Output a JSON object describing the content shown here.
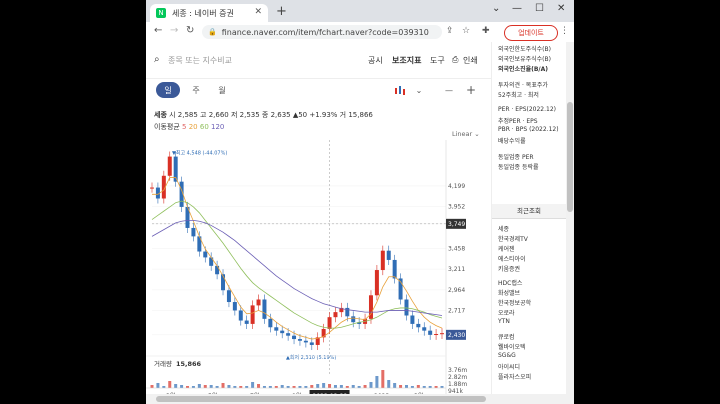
{
  "browser": {
    "tab_title": "세종 : 네이버 증권",
    "favicon_letter": "N",
    "url": "finance.naver.com/item/fchart.naver?code=039310",
    "update_label": "업데이트",
    "icons": [
      "back-icon",
      "forward-icon",
      "reload-icon",
      "lock-icon",
      "share-icon",
      "star-icon",
      "extensions-icon",
      "sidebar-icon",
      "profile-icon",
      "menu-icon"
    ]
  },
  "toolbar": {
    "search_placeholder": "종목 또는 지수비교",
    "links": [
      "공시",
      "보조지표",
      "도구",
      "인쇄"
    ]
  },
  "periods": [
    "일",
    "주",
    "월"
  ],
  "active_period": "일",
  "stock": {
    "name": "세종",
    "info": "시 2,585  고 2,660  저 2,535  종 2,635  ▲50  +1.93%  거 15,866",
    "ma_label": "이동평균",
    "ma_values": [
      "5",
      "20",
      "60",
      "120"
    ],
    "scale": "Linear"
  },
  "chart_data": {
    "type": "line",
    "x": [
      "3월",
      "5월",
      "7월",
      "9월",
      "11월",
      "2023",
      "3월"
    ],
    "y_ticks": [
      4199,
      3952,
      3749,
      3458,
      3211,
      2964,
      2717,
      2430
    ],
    "current_price": "2,430",
    "high_label": "▼최고 4,548 (-44.07%)",
    "low_label": "▲최저 2,310 (5.19%)",
    "crosshair_date": "2022-12-22",
    "volume_label": "거래량",
    "volume": "15,866",
    "volume_ticks": [
      "3.76m",
      "2.82m",
      "1.88m",
      "941k"
    ],
    "series": [
      {
        "values": [
          4180,
          4050,
          4320,
          4548,
          4250,
          3950,
          3700,
          3600,
          3420,
          3350,
          3250,
          3150,
          2960,
          2820,
          2720,
          2600,
          2560,
          2780,
          2850,
          2620,
          2520,
          2480,
          2450,
          2420,
          2380,
          2360,
          2340,
          2310,
          2400,
          2500,
          2640,
          2700,
          2750,
          2650,
          2580,
          2560,
          2620,
          2900,
          3200,
          3430,
          3320,
          3100,
          2850,
          2660,
          2560,
          2520,
          2480,
          2430,
          2440,
          2450
        ]
      },
      {
        "values": [
          4100,
          4100,
          4150,
          4300,
          4300,
          4150,
          3950,
          3780,
          3600,
          3450,
          3350,
          3250,
          3130,
          3000,
          2880,
          2760,
          2680,
          2690,
          2720,
          2690,
          2640,
          2580,
          2530,
          2490,
          2450,
          2420,
          2400,
          2380,
          2390,
          2410,
          2460,
          2520,
          2580,
          2620,
          2630,
          2620,
          2610,
          2680,
          2820,
          3000,
          3120,
          3120,
          3060,
          2950,
          2830,
          2720,
          2640,
          2580,
          2540,
          2510
        ]
      },
      {
        "values": [
          3800,
          3850,
          3900,
          3950,
          4000,
          4020,
          4000,
          3950,
          3880,
          3790,
          3700,
          3610,
          3520,
          3420,
          3320,
          3220,
          3130,
          3050,
          2990,
          2940,
          2890,
          2840,
          2790,
          2740,
          2690,
          2650,
          2610,
          2570,
          2540,
          2520,
          2510,
          2510,
          2520,
          2540,
          2560,
          2580,
          2590,
          2610,
          2640,
          2680,
          2720,
          2740,
          2750,
          2750,
          2740,
          2720,
          2700,
          2670,
          2650,
          2630
        ]
      },
      {
        "values": [
          3600,
          3640,
          3680,
          3720,
          3760,
          3780,
          3790,
          3790,
          3780,
          3760,
          3730,
          3690,
          3650,
          3600,
          3550,
          3490,
          3430,
          3370,
          3310,
          3250,
          3190,
          3130,
          3080,
          3030,
          2980,
          2940,
          2900,
          2860,
          2830,
          2800,
          2780,
          2760,
          2740,
          2730,
          2720,
          2710,
          2700,
          2700,
          2700,
          2710,
          2720,
          2720,
          2720,
          2720,
          2710,
          2700,
          2690,
          2680,
          2670,
          2660
        ]
      }
    ]
  },
  "colors": {
    "ma5": "#e06666",
    "ma20": "#e8a13a",
    "ma60": "#8fbf5c",
    "ma120": "#6b5fb5",
    "up": "#d93025",
    "down": "#2f6db5",
    "accent": "#3b5998"
  },
  "sidebar": {
    "items_top": [
      "외국인한도주식수(B)",
      "외국인보유주식수(B)",
      "외국인소진율(B/A)",
      "투자의견 · 목표주가",
      "52주최고 · 최저",
      "PER · EPS(2022.12)",
      "추정PER · EPS",
      "PBR · BPS (2022.12)",
      "배당수익률",
      "동일업종 PER",
      "동일업종 등락률"
    ],
    "recent_header": "최근조회",
    "recent_items": [
      "세종",
      "한국경제TV",
      "케어젠",
      "에스티아이",
      "키움증권",
      "HDC랩스",
      "화성밸브",
      "한국정보공학",
      "오로라",
      "YTN",
      "큐로컴",
      "웰바이오텍",
      "SG&G",
      "아이씨디",
      "플라자스오피"
    ]
  }
}
